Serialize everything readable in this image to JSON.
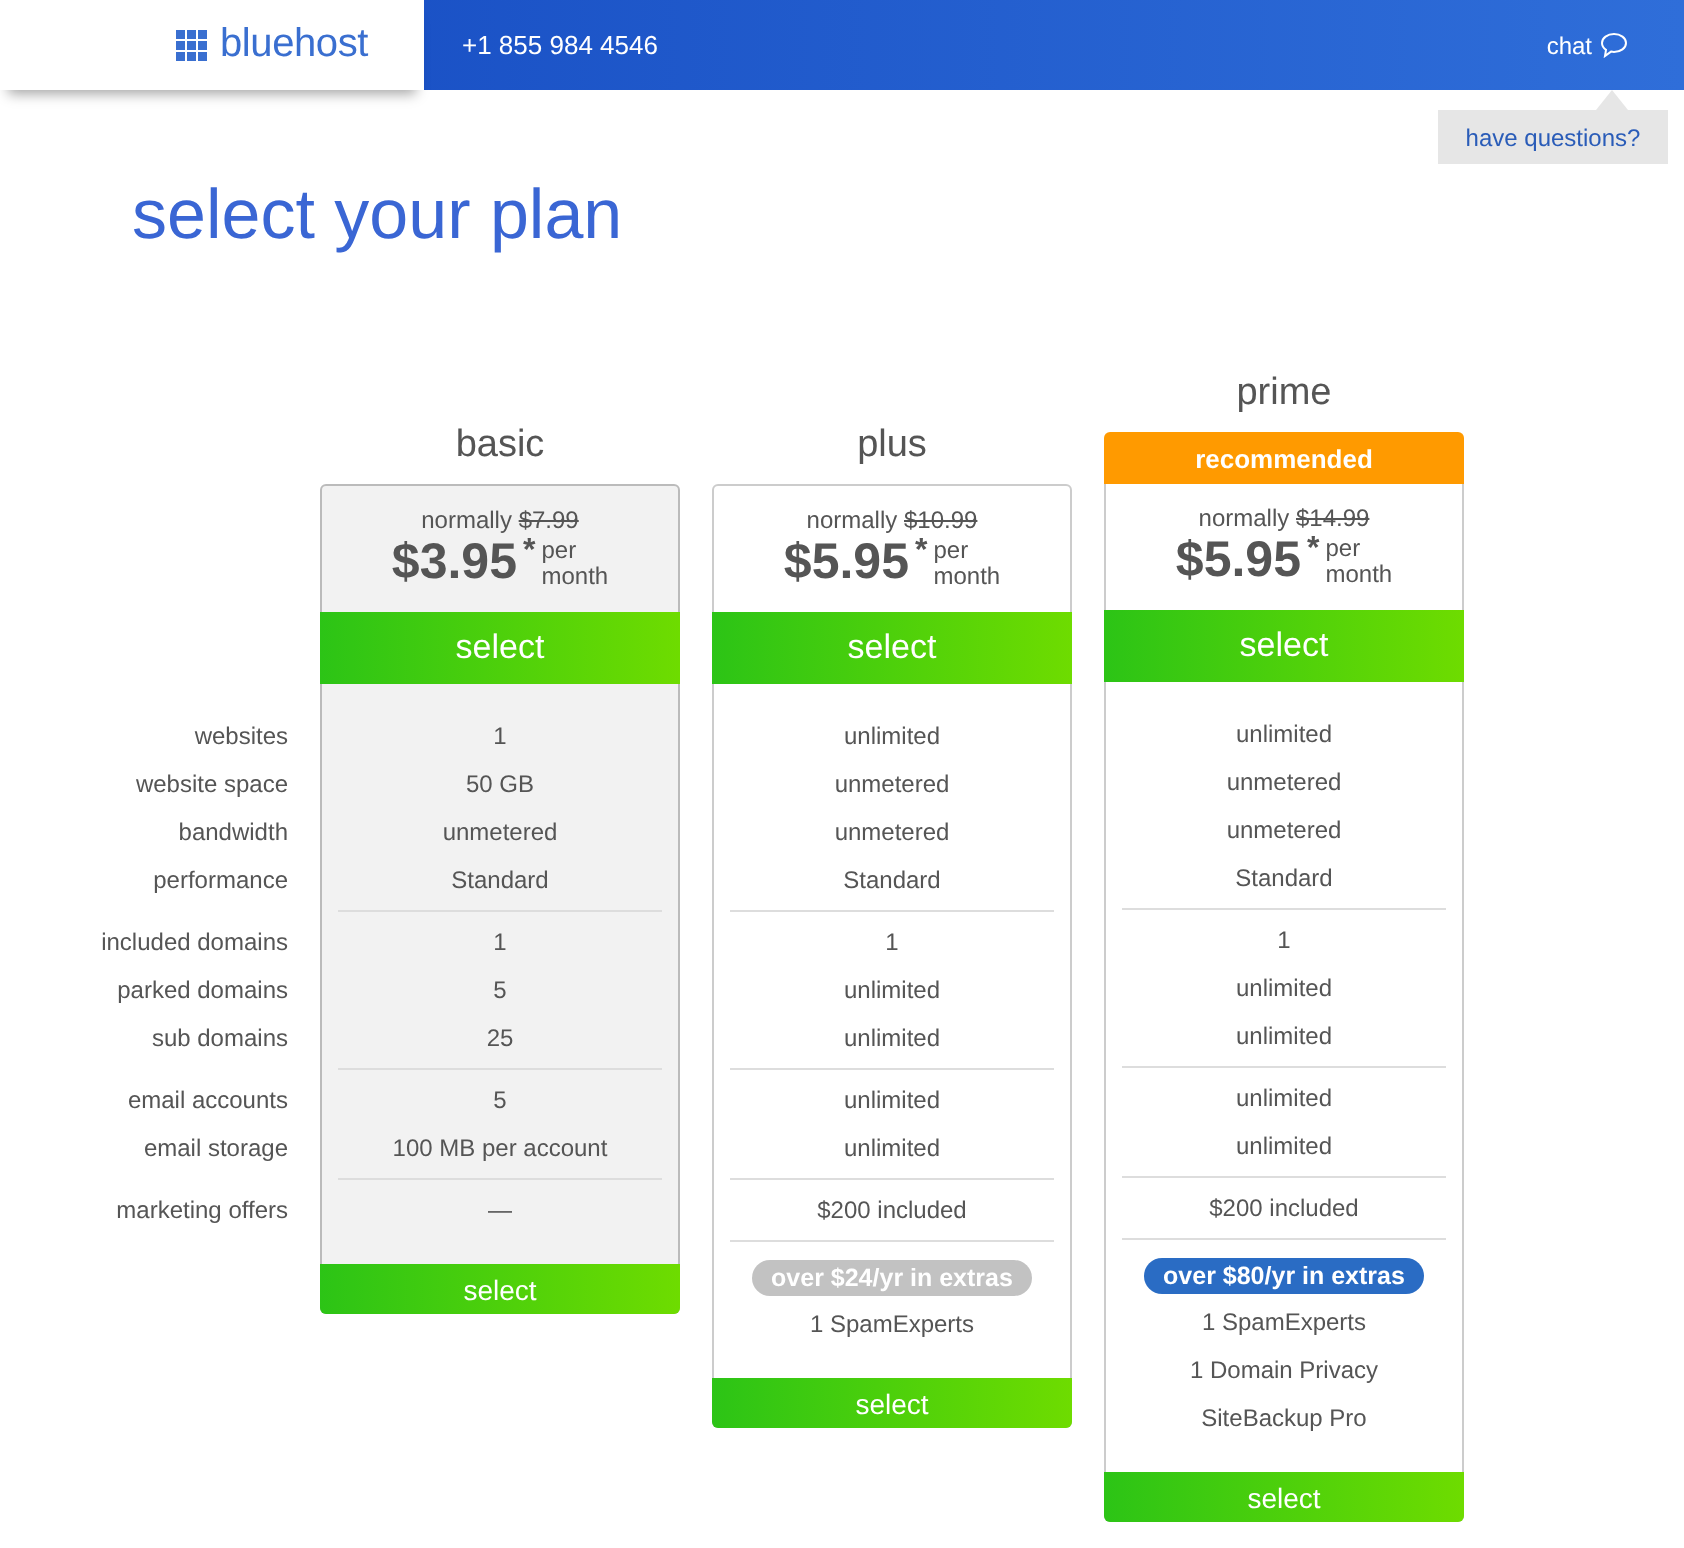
{
  "header": {
    "logo": "bluehost",
    "phone": "+1 855 984 4546",
    "chat": "chat",
    "tooltip": "have questions?"
  },
  "title": "select your plan",
  "feature_labels": [
    [
      "websites",
      "website space",
      "bandwidth",
      "performance"
    ],
    [
      "included domains",
      "parked domains",
      "sub domains"
    ],
    [
      "email accounts",
      "email storage"
    ],
    [
      "marketing offers"
    ]
  ],
  "plans": [
    {
      "name": "basic",
      "highlighted": true,
      "normally": "normally",
      "old_price": "$7.99",
      "currency": "$",
      "price": "3.95",
      "asterisk": "*",
      "per": "per",
      "month": "month",
      "select": "select",
      "groups": [
        [
          "1",
          "50 GB",
          "unmetered",
          "Standard"
        ],
        [
          "1",
          "5",
          "25"
        ],
        [
          "5",
          "100 MB per account"
        ],
        [
          "—"
        ]
      ],
      "bottom_select": "select"
    },
    {
      "name": "plus",
      "highlighted": false,
      "normally": "normally",
      "old_price": "$10.99",
      "currency": "$",
      "price": "5.95",
      "asterisk": "*",
      "per": "per",
      "month": "month",
      "select": "select",
      "groups": [
        [
          "unlimited",
          "unmetered",
          "unmetered",
          "Standard"
        ],
        [
          "1",
          "unlimited",
          "unlimited"
        ],
        [
          "unlimited",
          "unlimited"
        ],
        [
          "$200 included"
        ]
      ],
      "extras": {
        "label": "over $24/yr in extras",
        "color": "#c2c2c2",
        "items": [
          "1 SpamExperts"
        ]
      },
      "bottom_select": "select"
    },
    {
      "name": "prime",
      "highlighted": false,
      "badge": "recommended",
      "normally": "normally",
      "old_price": "$14.99",
      "currency": "$",
      "price": "5.95",
      "asterisk": "*",
      "per": "per",
      "month": "month",
      "select": "select",
      "groups": [
        [
          "unlimited",
          "unmetered",
          "unmetered",
          "Standard"
        ],
        [
          "1",
          "unlimited",
          "unlimited"
        ],
        [
          "unlimited",
          "unlimited"
        ],
        [
          "$200 included"
        ]
      ],
      "extras": {
        "label": "over $80/yr in extras",
        "color": "#2a6cc4",
        "items": [
          "1 SpamExperts",
          "1 Domain Privacy",
          "SiteBackup Pro"
        ]
      },
      "bottom_select": "select"
    }
  ]
}
